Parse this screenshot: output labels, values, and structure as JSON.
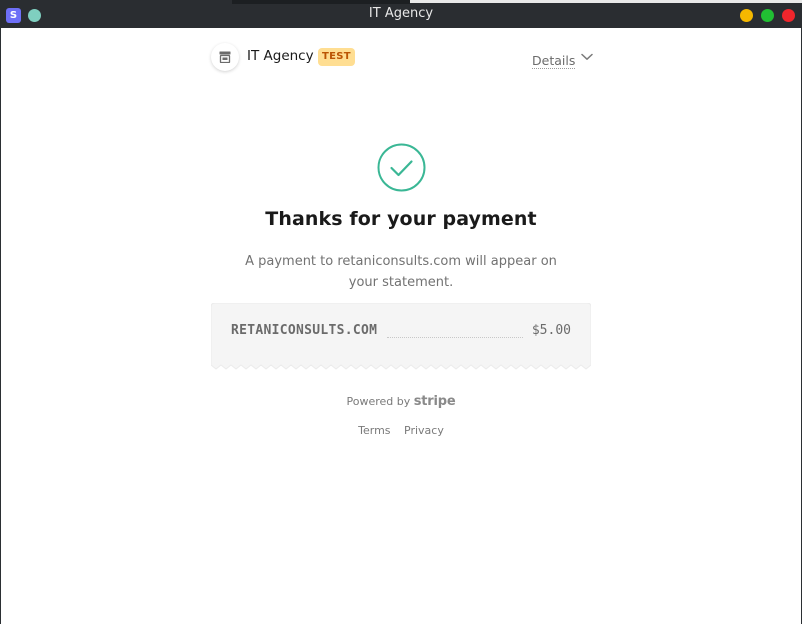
{
  "window": {
    "title": "IT Agency",
    "app_icon_letter": "S"
  },
  "header": {
    "merchant_name": "IT Agency",
    "badge": "TEST",
    "details_label": "Details"
  },
  "confirmation": {
    "title": "Thanks for your payment",
    "message": "A payment to retaniconsults.com will appear on your statement."
  },
  "receipt": {
    "descriptor": "RETANICONSULTS.COM",
    "amount": "$5.00"
  },
  "footer": {
    "powered_by": "Powered by",
    "brand": "stripe",
    "links": [
      "Terms",
      "Privacy"
    ]
  },
  "colors": {
    "success": "#3ab795",
    "badge_bg": "#ffde92",
    "badge_text": "#bb5504",
    "titlebar": "#2a2d31"
  },
  "icons": {
    "merchant": "storefront-icon",
    "details": "chevron-down-icon",
    "success": "check-circle-icon"
  }
}
